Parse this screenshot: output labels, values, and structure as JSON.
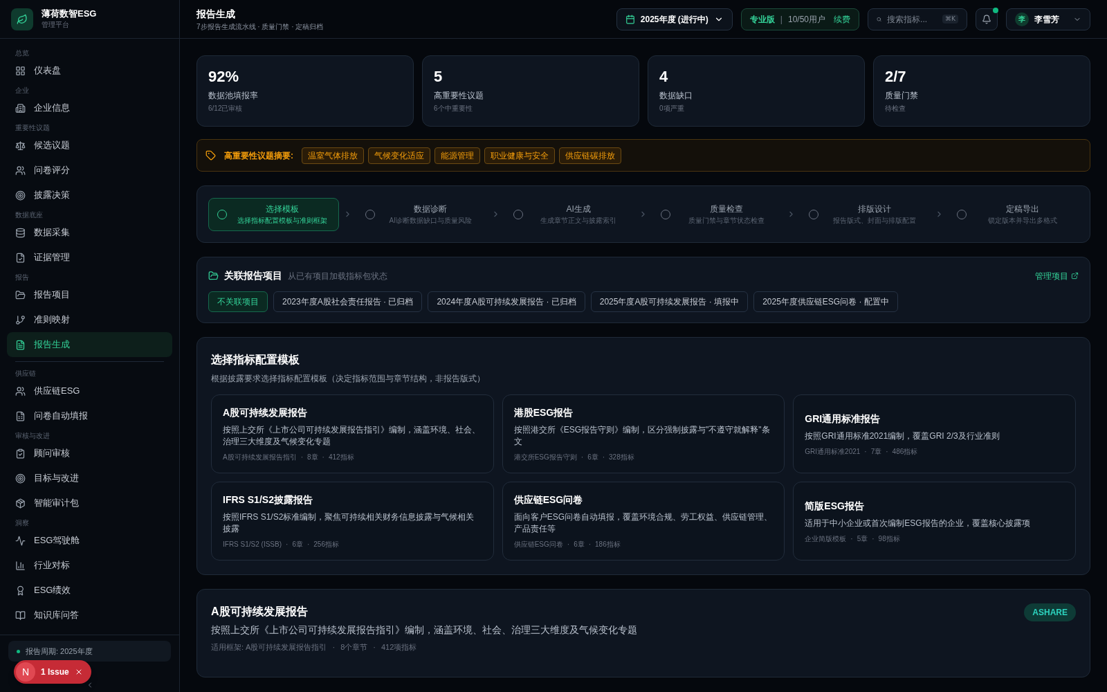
{
  "brand": {
    "name": "薄荷数智ESG",
    "subtitle": "管理平台"
  },
  "sidebar": {
    "sections": [
      {
        "label": "总览",
        "items": [
          {
            "label": "仪表盘",
            "selected": false
          }
        ]
      },
      {
        "label": "企业",
        "items": [
          {
            "label": "企业信息",
            "selected": false
          }
        ]
      },
      {
        "label": "重要性议题",
        "items": [
          {
            "label": "候选议题",
            "selected": false
          },
          {
            "label": "问卷评分",
            "selected": false
          },
          {
            "label": "披露决策",
            "selected": false
          }
        ]
      },
      {
        "label": "数据底座",
        "items": [
          {
            "label": "数据采集",
            "selected": false
          },
          {
            "label": "证据管理",
            "selected": false
          }
        ]
      },
      {
        "label": "报告",
        "items": [
          {
            "label": "报告项目",
            "selected": false
          },
          {
            "label": "准则映射",
            "selected": false
          },
          {
            "label": "报告生成",
            "selected": true
          }
        ]
      },
      {
        "label": "供应链",
        "items": [
          {
            "label": "供应链ESG",
            "selected": false
          },
          {
            "label": "问卷自动填报",
            "selected": false
          }
        ]
      },
      {
        "label": "审核与改进",
        "items": [
          {
            "label": "顾问审核",
            "selected": false
          },
          {
            "label": "目标与改进",
            "selected": false
          },
          {
            "label": "智能审计包",
            "selected": false
          }
        ]
      },
      {
        "label": "洞察",
        "items": [
          {
            "label": "ESG驾驶舱",
            "selected": false
          },
          {
            "label": "行业对标",
            "selected": false
          },
          {
            "label": "ESG绩效",
            "selected": false
          },
          {
            "label": "知识库问答",
            "selected": false
          }
        ]
      }
    ],
    "period": "报告周期: 2025年度",
    "issue": {
      "letter": "N",
      "label": "1 Issue"
    }
  },
  "header": {
    "title": "报告生成",
    "subtitle": "7步报告生成流水线 · 质量门禁 · 定稿归档",
    "year": "2025年度 (进行中)",
    "plan": "专业版",
    "separator": "|",
    "users": "10/50用户",
    "renew": "续费",
    "search_placeholder": "搜索指标...",
    "shortcut": "⌘K",
    "notification_dot": true,
    "avatar": "李",
    "user": "李雪芳"
  },
  "stats": [
    {
      "value": "92%",
      "label": "数据池填报率",
      "sub": "6/12已审核"
    },
    {
      "value": "5",
      "label": "高重要性议题",
      "sub": "6个中重要性"
    },
    {
      "value": "4",
      "label": "数据缺口",
      "sub": "0项严重"
    },
    {
      "value": "2/7",
      "label": "质量门禁",
      "sub": "待检查"
    }
  ],
  "summary": {
    "label": "高重要性议题摘要:",
    "tags": [
      "温室气体排放",
      "气候变化适应",
      "能源管理",
      "职业健康与安全",
      "供应链碳排放"
    ]
  },
  "steps": [
    {
      "title": "选择模板",
      "subtitle": "选择指标配置模板与准则框架",
      "selected": true
    },
    {
      "title": "数据诊断",
      "subtitle": "AI诊断数据缺口与质量风险",
      "selected": false
    },
    {
      "title": "AI生成",
      "subtitle": "生成章节正文与披露索引",
      "selected": false
    },
    {
      "title": "质量检查",
      "subtitle": "质量门禁与章节状态检查",
      "selected": false
    },
    {
      "title": "排版设计",
      "subtitle": "报告版式、封面与排版配置",
      "selected": false
    },
    {
      "title": "定稿导出",
      "subtitle": "锁定版本并导出多格式",
      "selected": false
    }
  ],
  "projects": {
    "title": "关联报告项目",
    "hint": "从已有项目加载指标包状态",
    "manage": "管理项目",
    "chips": [
      {
        "label": "不关联项目",
        "selected": true
      },
      {
        "label": "2023年度A股社会责任报告 · 已归档",
        "selected": false
      },
      {
        "label": "2024年度A股可持续发展报告 · 已归档",
        "selected": false
      },
      {
        "label": "2025年度A股可持续发展报告 · 填报中",
        "selected": false
      },
      {
        "label": "2025年度供应链ESG问卷 · 配置中",
        "selected": false
      }
    ]
  },
  "templates": {
    "separator": "·",
    "title": "选择指标配置模板",
    "subtitle": "根据披露要求选择指标配置模板（决定指标范围与章节结构，非报告版式）",
    "items": [
      {
        "title": "A股可持续发展报告",
        "description": "按照上交所《上市公司可持续发展报告指引》编制，涵盖环境、社会、治理三大维度及气候变化专题",
        "meta": [
          "A股可持续发展报告指引",
          "8章",
          "412指标"
        ]
      },
      {
        "title": "港股ESG报告",
        "description": "按照港交所《ESG报告守则》编制，区分强制披露与\"不遵守就解释\"条文",
        "meta": [
          "港交所ESG报告守则",
          "6章",
          "328指标"
        ]
      },
      {
        "title": "GRI通用标准报告",
        "description": "按照GRI通用标准2021编制，覆盖GRI 2/3及行业准则",
        "meta": [
          "GRI通用标准2021",
          "7章",
          "486指标"
        ]
      },
      {
        "title": "IFRS S1/S2披露报告",
        "description": "按照IFRS S1/S2标准编制，聚焦可持续相关财务信息披露与气候相关披露",
        "meta": [
          "IFRS S1/S2 (ISSB)",
          "6章",
          "256指标"
        ]
      },
      {
        "title": "供应链ESG问卷",
        "description": "面向客户ESG问卷自动填报，覆盖环境合规、劳工权益、供应链管理、产品责任等",
        "meta": [
          "供应链ESG问卷",
          "6章",
          "186指标"
        ]
      },
      {
        "title": "简版ESG报告",
        "description": "适用于中小企业或首次编制ESG报告的企业，覆盖核心披露项",
        "meta": [
          "企业简版模板",
          "5章",
          "98指标"
        ]
      }
    ]
  },
  "detail": {
    "separator": "·",
    "title": "A股可持续发展报告",
    "description": "按照上交所《上市公司可持续发展报告指引》编制，涵盖环境、社会、治理三大维度及气候变化专题",
    "meta": [
      "适用框架: A股可持续发展报告指引",
      "8个章节",
      "412项指标"
    ],
    "badge": "ASHARE"
  }
}
